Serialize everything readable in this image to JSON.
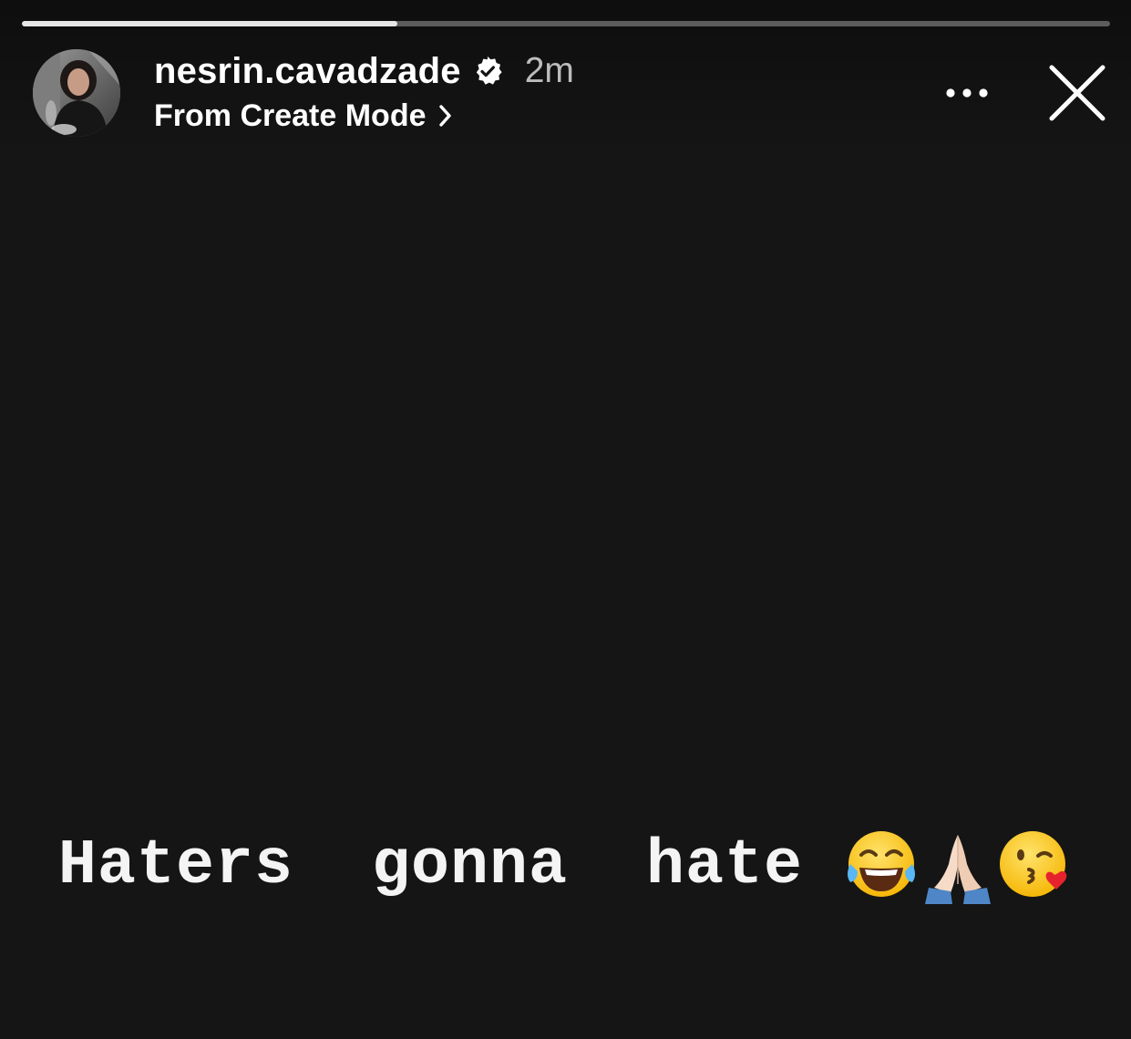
{
  "story": {
    "progress": 0.345,
    "user": {
      "username": "nesrin.cavadzade",
      "verified": true,
      "time_ago": "2m",
      "subtitle": "From Create Mode"
    },
    "caption": "Haters  gonna  hate",
    "emojis": [
      "tears-of-joy-emoji",
      "folded-hands-emoji",
      "face-blowing-kiss-emoji"
    ]
  },
  "icons": {
    "verified": "verified-badge-icon",
    "chevron": "chevron-right-icon",
    "more": "more-options-icon",
    "close": "close-icon"
  },
  "colors": {
    "background": "#151515",
    "text": "#ffffff",
    "muted_text": "#b8b8b8"
  }
}
